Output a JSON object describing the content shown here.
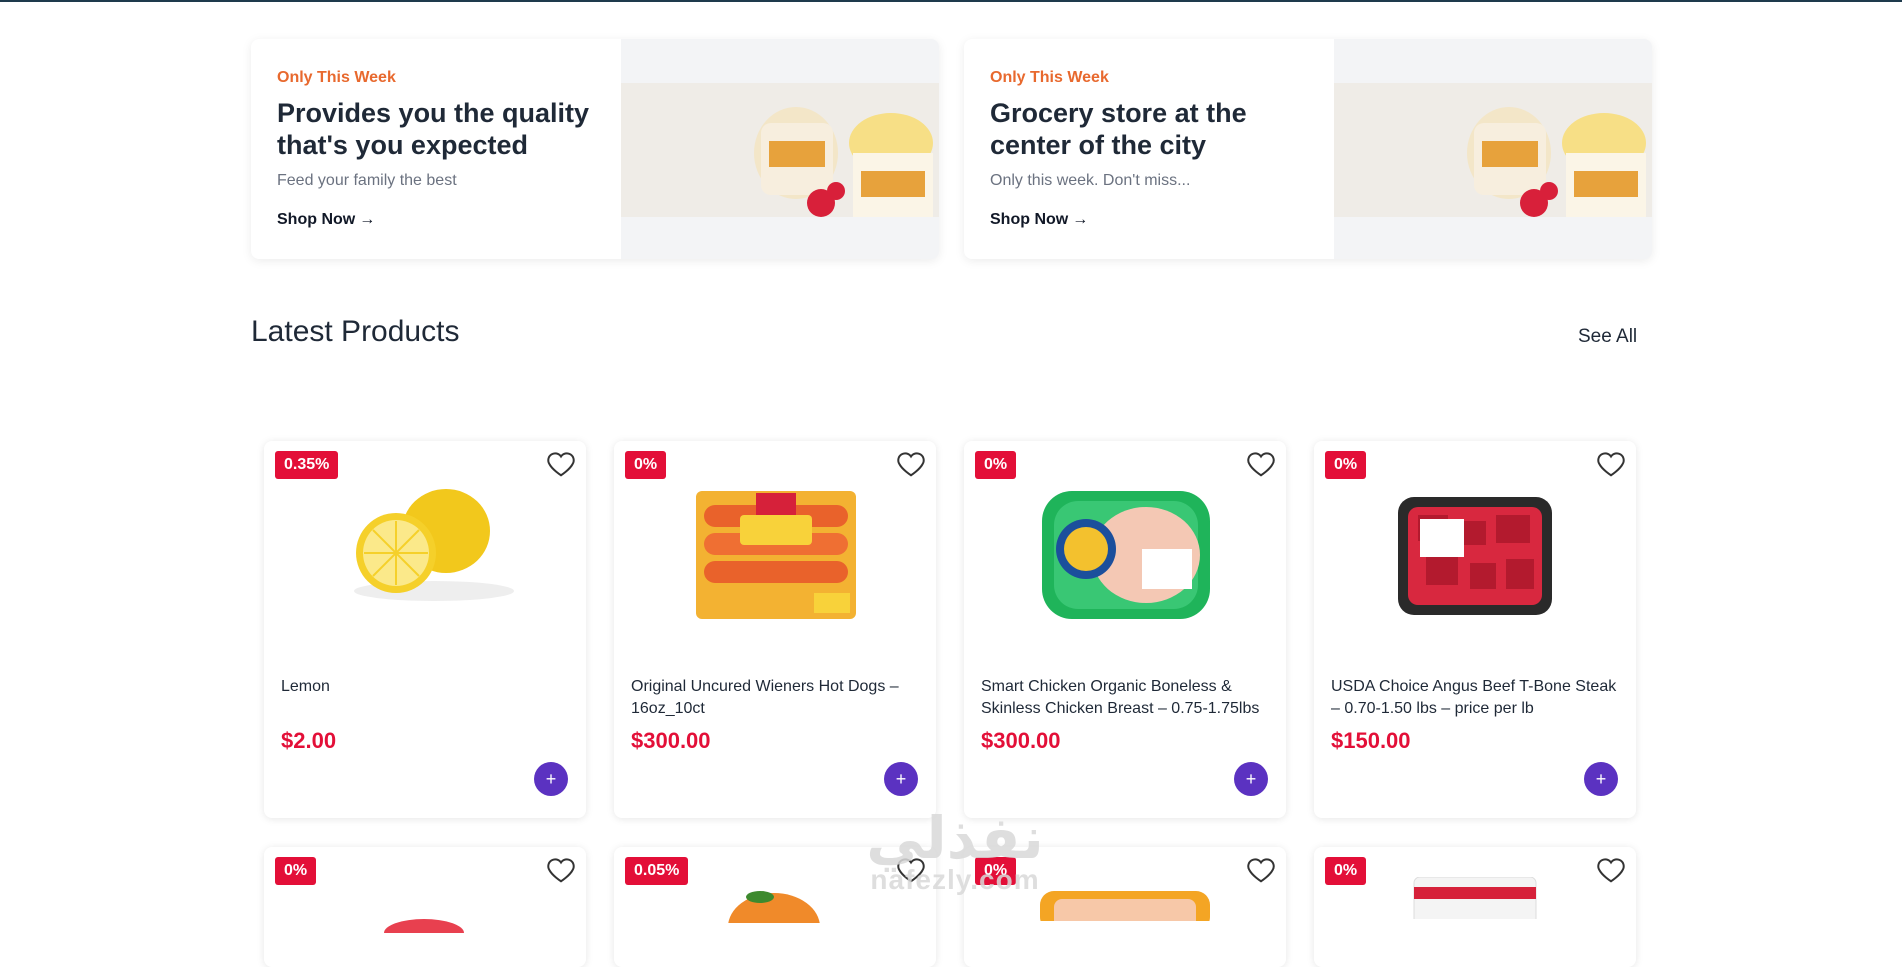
{
  "promos": [
    {
      "eyebrow": "Only This Week",
      "title": "Provides you the quality that's you expected",
      "subtitle": "Feed your family the best",
      "cta": "Shop Now",
      "cta_icon": "arrow-right-icon"
    },
    {
      "eyebrow": "Only This Week",
      "title": "Grocery store at the center of the city",
      "subtitle": "Only this week. Don't miss...",
      "cta": "Shop Now",
      "cta_icon": "arrow-right-icon"
    }
  ],
  "latest": {
    "title": "Latest Products",
    "see_all": "See All",
    "products": [
      {
        "badge": "0.35%",
        "name": "Lemon",
        "price": "$2.00",
        "image": "lemon"
      },
      {
        "badge": "0%",
        "name": "Original Uncured Wieners Hot Dogs – 16oz_10ct",
        "price": "$300.00",
        "image": "hot-dogs-pack"
      },
      {
        "badge": "0%",
        "name": "Smart Chicken Organic Boneless & Skinless Chicken Breast – 0.75-1.75lbs",
        "price": "$300.00",
        "image": "chicken-breast-pack"
      },
      {
        "badge": "0%",
        "name": "USDA Choice Angus Beef T-Bone Steak – 0.70-1.50 lbs – price per lb",
        "price": "$150.00",
        "image": "beef-tray"
      }
    ],
    "second_row_badges": [
      "0%",
      "0.05%",
      "0%",
      "0%"
    ]
  },
  "ui": {
    "favorite_icon": "heart-icon",
    "add_icon": "plus-icon",
    "add_label": "+",
    "arrow": "→"
  },
  "watermark": {
    "arabic": "نفذلي",
    "latin": "nafezly.com"
  },
  "colors": {
    "accent": "#5b32c1",
    "badge": "#e30f38",
    "eyebrow": "#e8692e",
    "price": "#e30f38"
  }
}
